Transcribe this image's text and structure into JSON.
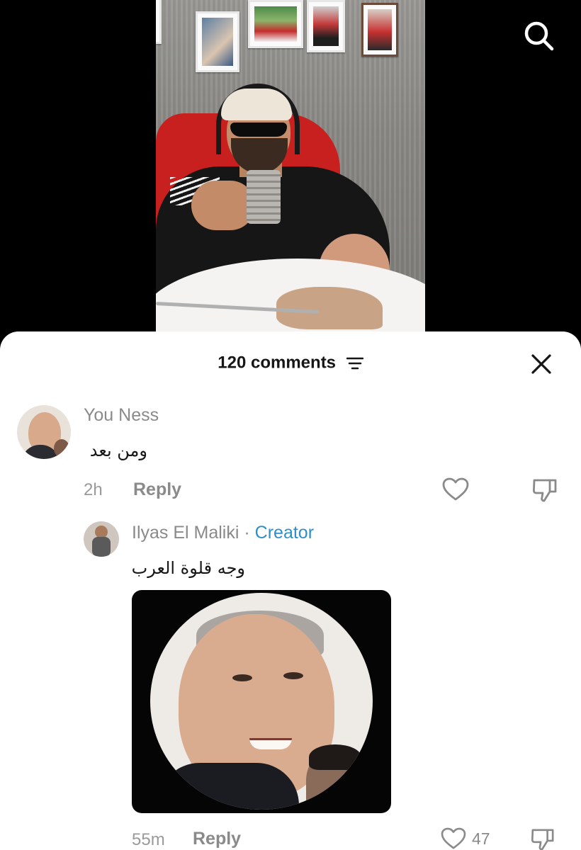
{
  "sheet": {
    "comments_count": "120 comments"
  },
  "comments": [
    {
      "author": "You Ness",
      "text": "ومن بعد",
      "time": "2h",
      "reply_label": "Reply"
    },
    {
      "author": "Ilyas El Maliki",
      "separator": "·",
      "badge": "Creator",
      "text": "وجه قلوة العرب",
      "time": "55m",
      "reply_label": "Reply",
      "likes": "47"
    }
  ],
  "icons": {
    "search": "search-icon",
    "filter": "filter-icon",
    "close": "close-icon",
    "like": "heart-icon",
    "dislike": "thumbs-down-icon"
  },
  "colors": {
    "creator_badge": "#2e8fc9",
    "muted_text": "#8a8a8a",
    "sheet_bg": "#ffffff"
  }
}
